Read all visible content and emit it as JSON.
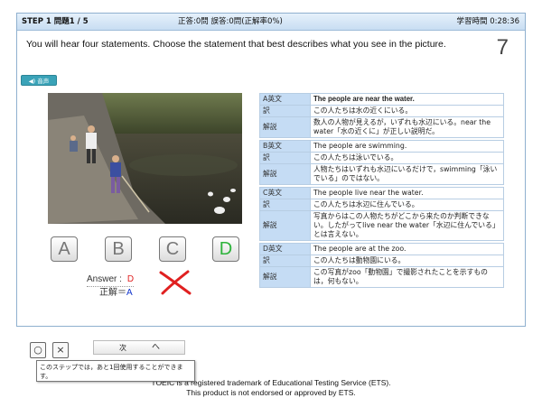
{
  "topbar": {
    "step": "STEP 1  問題1 / 5",
    "score": "正答:0問   誤答:0問(正解率0%)",
    "timer": "学習時間  0:28:36"
  },
  "question": {
    "text": "You will hear four statements. Choose the statement that best describes what you see in the picture.",
    "number": "7",
    "audio_label": "◀) 音声"
  },
  "choices": [
    "A",
    "B",
    "C",
    "D"
  ],
  "correct_choice": "D",
  "answer": {
    "answer_label": "Answer :",
    "answer_value": "D",
    "correct_label": "正解＝",
    "correct_value": "A"
  },
  "explanations": [
    {
      "label": "A英文",
      "text": "The people are near the water."
    },
    {
      "label": "訳",
      "text": "この人たちは水の近くにいる。"
    },
    {
      "label": "解説",
      "text": "数人の人物が見えるが，いずれも水辺にいる。near the water「水の近くに」が正しい説明だ。"
    },
    {
      "label": "B英文",
      "text": "The people are swimming."
    },
    {
      "label": "訳",
      "text": "この人たちは泳いでいる。"
    },
    {
      "label": "解説",
      "text": "人物たちはいずれも水辺にいるだけで，swimming「泳いでいる」のではない。"
    },
    {
      "label": "C英文",
      "text": "The people live near the water."
    },
    {
      "label": "訳",
      "text": "この人たちは水辺に住んでいる。"
    },
    {
      "label": "解説",
      "text": "写真からはこの人物たちがどこから来たのか判断できない。したがってlive near the water「水辺に住んでいる」とは言えない。"
    },
    {
      "label": "D英文",
      "text": "The people are at the zoo."
    },
    {
      "label": "訳",
      "text": "この人たちは動物園にいる。"
    },
    {
      "label": "解説",
      "text": "この写真がzoo「動物園」で撮影されたことを示すものは，何もない。"
    }
  ],
  "controls": {
    "circle": "○",
    "cross": "×",
    "next_label": "次",
    "up_label": "へ"
  },
  "tooltip": "このステップでは，あと1回使用することができます。",
  "footer": {
    "line1": "TOEIC is a registered trademark of Educational Testing Service (ETS).",
    "line2": "This product is not endorsed or approved by ETS."
  },
  "colors": {
    "header_bg": "#c8ddf2",
    "label_bg": "#c5dcf4",
    "correct_green": "#2db33b",
    "wrong_red": "#e02020",
    "answer_blue": "#1033cc"
  }
}
